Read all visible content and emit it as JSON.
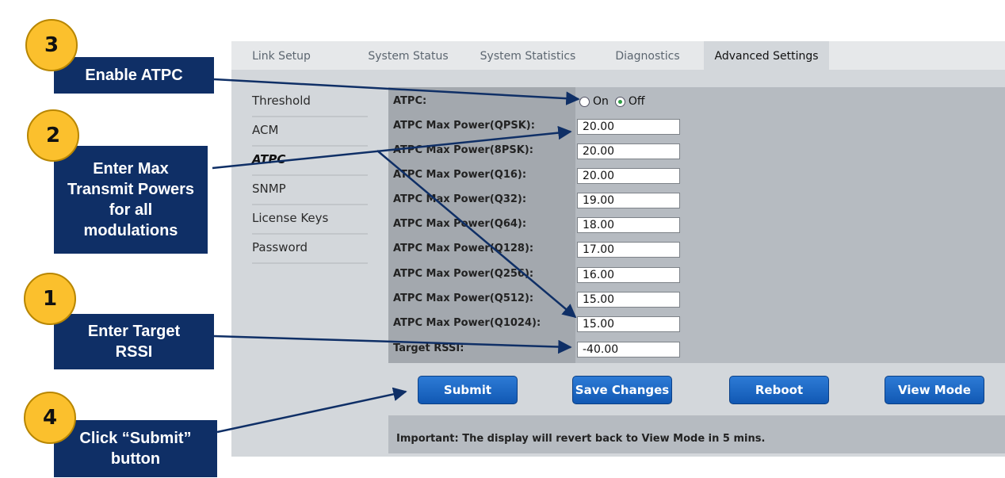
{
  "tabs": [
    "Link Setup",
    "System Status",
    "System Statistics",
    "Diagnostics",
    "Advanced Settings"
  ],
  "active_tab": "Advanced Settings",
  "sidebar": [
    "Threshold",
    "ACM",
    "ATPC",
    "SNMP",
    "License Keys",
    "Password"
  ],
  "active_sidebar": "ATPC",
  "atpc": {
    "label": "ATPC:",
    "on_label": "On",
    "off_label": "Off",
    "selected": "Off"
  },
  "rows": [
    {
      "label": "ATPC Max Power(QPSK):",
      "value": "20.00"
    },
    {
      "label": "ATPC Max Power(8PSK):",
      "value": "20.00"
    },
    {
      "label": "ATPC Max Power(Q16):",
      "value": "20.00"
    },
    {
      "label": "ATPC Max Power(Q32):",
      "value": "19.00"
    },
    {
      "label": "ATPC Max Power(Q64):",
      "value": "18.00"
    },
    {
      "label": "ATPC Max Power(Q128):",
      "value": "17.00"
    },
    {
      "label": "ATPC Max Power(Q256):",
      "value": "16.00"
    },
    {
      "label": "ATPC Max Power(Q512):",
      "value": "15.00"
    },
    {
      "label": "ATPC Max Power(Q1024):",
      "value": "15.00"
    },
    {
      "label": "Target RSSI:",
      "value": "-40.00"
    }
  ],
  "buttons": {
    "submit": "Submit",
    "save": "Save Changes",
    "reboot": "Reboot",
    "view_mode": "View Mode"
  },
  "notice": "Important: The display will revert back to View Mode in 5 mins.",
  "annotations": [
    {
      "number": "3",
      "text": "Enable ATPC"
    },
    {
      "number": "2",
      "text": "Enter Max Transmit Powers for all modulations"
    },
    {
      "number": "1",
      "text": "Enter Target RSSI"
    },
    {
      "number": "4",
      "text": "Click “Submit” button"
    }
  ],
  "colors": {
    "callout_bg": "#0f2f66",
    "circle_fill": "#fbc02d",
    "button_blue": "#1a6cc8",
    "panel_gray": "#d3d7db"
  }
}
